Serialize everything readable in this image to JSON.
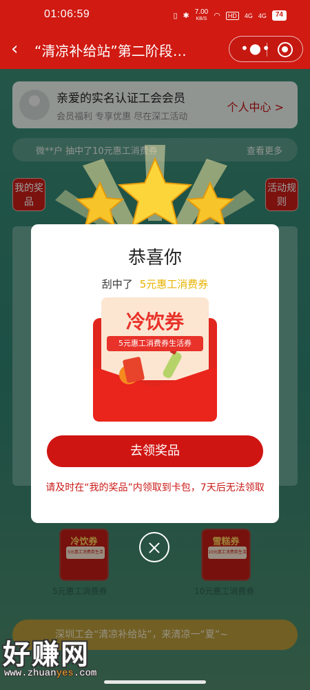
{
  "status": {
    "time": "01:06:59",
    "net_speed": "7.00",
    "net_unit": "KB/S",
    "hd": "HD",
    "signal1": "4G",
    "signal2": "4G",
    "battery": "74"
  },
  "titlebar": {
    "title": "“清凉补给站”第二阶段…"
  },
  "member": {
    "name": "亲爱的实名认证工会会员",
    "subtitle": "会员福利 专享优惠 尽在深工活动",
    "center_link": "个人中心 >"
  },
  "notice": {
    "left": "微**户 抽中了10元惠工消费券",
    "right": "查看更多"
  },
  "side": {
    "my_prizes": "我的奖品",
    "rules": "活动规则"
  },
  "bottom_coupons": [
    {
      "title": "冷饮券",
      "sub": "5元惠工消费券生活券",
      "caption": "5元惠工消费券"
    },
    {
      "title": "雪糕券",
      "sub": "10元惠工消费券生活券",
      "caption": "10元惠工消费券"
    }
  ],
  "banner_text": "深圳工会“清凉补给站”，来清凉一“夏”~",
  "modal": {
    "title": "恭喜你",
    "won_prefix": "刮中了",
    "won_prize": "5元惠工消费券",
    "coupon_title": "冷饮券",
    "coupon_sub": "5元惠工消费券生活券",
    "claim_button": "去领奖品",
    "tip": "请及时在“我的奖品”内领取到卡包，7天后无法领取"
  },
  "watermark": {
    "brand": "好赚网",
    "url_pre": "www.zhuan",
    "url_hl": "yes",
    "url_post": ".com"
  },
  "colors": {
    "primary_red": "#d01a12",
    "gold": "#e7b300",
    "teal_bg": "#3a8b75"
  }
}
